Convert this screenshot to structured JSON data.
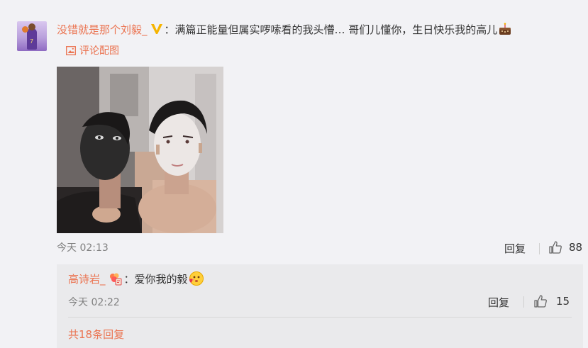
{
  "comment": {
    "username": "没错就是那个刘毅_",
    "separator": "：",
    "text": "满篇正能量但属实啰嗦看的我头懵… 哥们儿懂你，生日快乐我的高儿",
    "pic_link": "评论配图",
    "time": "今天 02:13",
    "reply_label": "回复",
    "like_count": "88"
  },
  "subcomment": {
    "username": "高诗岩_",
    "separator": "：",
    "text": "爱你我的毅",
    "time": "今天 02:22",
    "reply_label": "回复",
    "like_count": "15"
  },
  "more_replies": "共18条回复",
  "avatar_number": "7",
  "colors": {
    "accent": "#eb7350",
    "background": "#f2f2f5",
    "subcomment_bg": "#eaeaec"
  },
  "icons": [
    "vip-v-icon",
    "cake-emoji-icon",
    "picture-icon",
    "like-icon",
    "flower-badge-icon",
    "love-face-emoji-icon"
  ]
}
